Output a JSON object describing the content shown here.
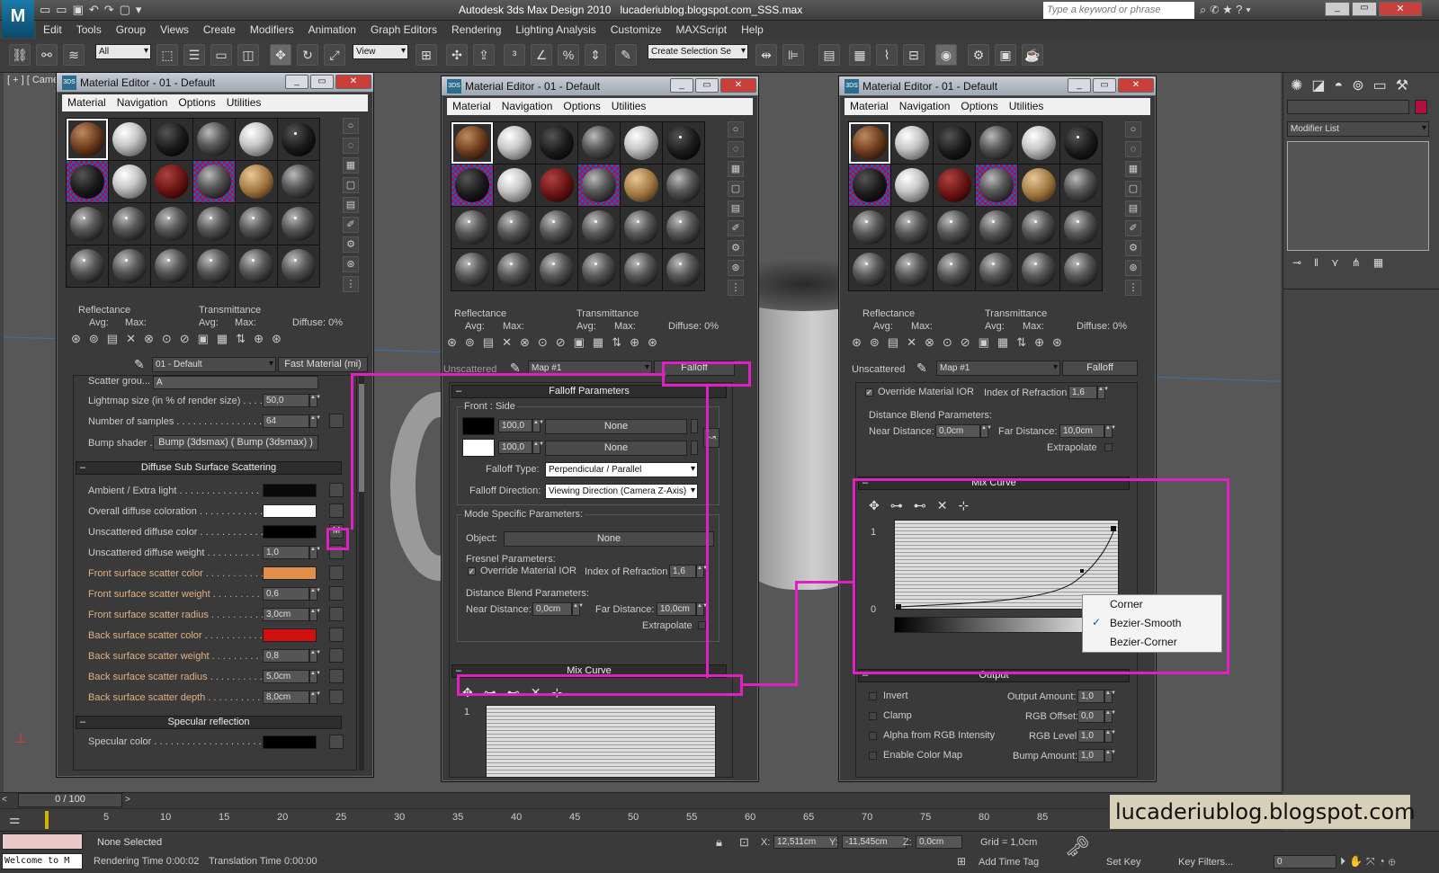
{
  "app": {
    "title": "Autodesk 3ds Max Design 2010",
    "file": "lucaderiublog.blogspot.com_SSS.max",
    "search_placeholder": "Type a keyword or phrase"
  },
  "menu": [
    "Edit",
    "Tools",
    "Group",
    "Views",
    "Create",
    "Modifiers",
    "Animation",
    "Graph Editors",
    "Rendering",
    "Lighting Analysis",
    "Customize",
    "MAXScript",
    "Help"
  ],
  "toolbar": {
    "filter": "All",
    "refcoord": "View",
    "selset": "Create Selection Se"
  },
  "viewport": {
    "label": "[ + ] [ Came"
  },
  "cmdpanel": {
    "modifier_list": "Modifier List"
  },
  "mat_editor": {
    "title": "Material Editor - 01 - Default",
    "menu": [
      "Material",
      "Navigation",
      "Options",
      "Utilities"
    ],
    "reflectance": "Reflectance",
    "transmittance": "Transmittance",
    "avg": "Avg:",
    "max": "Max:",
    "diffuse": "Diffuse:  0%"
  },
  "left": {
    "mat_name": "01 - Default",
    "mat_type": "Fast Material (mi)",
    "scatter_group": "Scatter grou...",
    "scatter_val": "A",
    "rows1": [
      {
        "label": "Lightmap size (in % of render size) . . . . . . .",
        "value": "50,0"
      },
      {
        "label": "Number of samples . . . . . . . . . . . . . . . . . .",
        "value": "64"
      }
    ],
    "bump_label": "Bump shader . . . . . . .",
    "bump_value": "Bump (3dsmax)  ( Bump (3dsmax) )",
    "sss_header": "Diffuse Sub Surface Scattering",
    "sss": [
      {
        "label": "Ambient / Extra light . . . . . . . . . . . . . . . . .",
        "color": "#0a0a0a"
      },
      {
        "label": "Overall diffuse coloration . . . . . . . . . . . . .",
        "color": "#ffffff"
      },
      {
        "label": "Unscattered diffuse color . . . . . . . . . . . . .",
        "color": "#000000"
      },
      {
        "label": "Unscattered diffuse weight . . . . . . . . . . . .",
        "value": "1,0"
      },
      {
        "label": "Front surface scatter color . . . . . . . . . . . .",
        "color": "#e0904a"
      },
      {
        "label": "Front surface scatter weight . . . . . . . . . . .",
        "value": "0,6"
      },
      {
        "label": "Front surface scatter radius . . . . . . . . . . .",
        "value": "3,0cm"
      },
      {
        "label": "Back surface scatter color . . . . . . . . . . . .",
        "color": "#d01010"
      },
      {
        "label": "Back surface scatter weight . . . . . . . . . . .",
        "value": "0,8"
      },
      {
        "label": "Back surface scatter radius . . . . . . . . . . .",
        "value": "5,0cm"
      },
      {
        "label": "Back surface scatter depth . . . . . . . . . . . .",
        "value": "8,0cm"
      }
    ],
    "m_button": "M",
    "spec_header": "Specular reflection",
    "spec_label": "Specular color . . . . . . . . . . . . . . . . . . . ."
  },
  "middle": {
    "unscattered": "Unscattered",
    "map_name": "Map #1",
    "map_type": "Falloff",
    "falloff_header": "Falloff Parameters",
    "front_side": "Front : Side",
    "amt1": "100,0",
    "amt2": "100,0",
    "none": "None",
    "falloff_type_label": "Falloff Type:",
    "falloff_type": "Perpendicular / Parallel",
    "falloff_dir_label": "Falloff Direction:",
    "falloff_dir": "Viewing Direction (Camera Z-Axis)",
    "mode_specific": "Mode Specific Parameters:",
    "object_label": "Object:",
    "fresnel": "Fresnel Parameters:",
    "override_ior": "Override Material IOR",
    "ior_label": "Index of Refraction",
    "ior": "1,6",
    "dist_blend": "Distance Blend Parameters:",
    "near_label": "Near Distance:",
    "near": "0,0cm",
    "far_label": "Far Distance:",
    "far": "10,0cm",
    "extrapolate": "Extrapolate",
    "mix_curve": "Mix Curve",
    "one": "1"
  },
  "right": {
    "unscattered": "Unscattered",
    "map_name": "Map #1",
    "map_type": "Falloff",
    "override_ior": "Override Material IOR",
    "ior_label": "Index of Refraction",
    "ior": "1,6",
    "dist_blend": "Distance Blend Parameters:",
    "near_label": "Near Distance:",
    "near": "0,0cm",
    "far_label": "Far Distance:",
    "far": "10,0cm",
    "extrapolate": "Extrapolate",
    "mix_curve": "Mix Curve",
    "one": "1",
    "zero": "0",
    "context": [
      "Corner",
      "Bezier-Smooth",
      "Bezier-Corner"
    ],
    "output_header": "Output",
    "invert": "Invert",
    "clamp": "Clamp",
    "alpha_rgb": "Alpha from RGB Intensity",
    "enable_cmap": "Enable Color Map",
    "out_amt_label": "Output Amount:",
    "out_amt": "1,0",
    "rgb_off_label": "RGB Offset:",
    "rgb_off": "0,0",
    "rgb_lvl_label": "RGB Level:",
    "rgb_lvl": "1,0",
    "bump_amt_label": "Bump Amount:",
    "bump_amt": "1,0"
  },
  "timeline": {
    "frame": "0 / 100",
    "ticks": [
      "5",
      "10",
      "15",
      "20",
      "25",
      "30",
      "35",
      "40",
      "45",
      "50",
      "55",
      "60",
      "65",
      "70",
      "75",
      "80",
      "85"
    ]
  },
  "status": {
    "selection": "None Selected",
    "welcome": "Welcome to M",
    "render_time": "Rendering Time  0:00:02",
    "translation_time": "Translation Time  0:00:00",
    "x_label": "X:",
    "x": "12,511cm",
    "y_label": "Y:",
    "y": "-11,545cm",
    "z_label": "Z:",
    "z": "0,0cm",
    "grid": "Grid = 1,0cm",
    "add_time_tag": "Add Time Tag",
    "set_key": "Set Key",
    "key_filters": "Key Filters...",
    "frame_val": "0"
  },
  "watermark": "lucaderiublog.blogspot.com"
}
